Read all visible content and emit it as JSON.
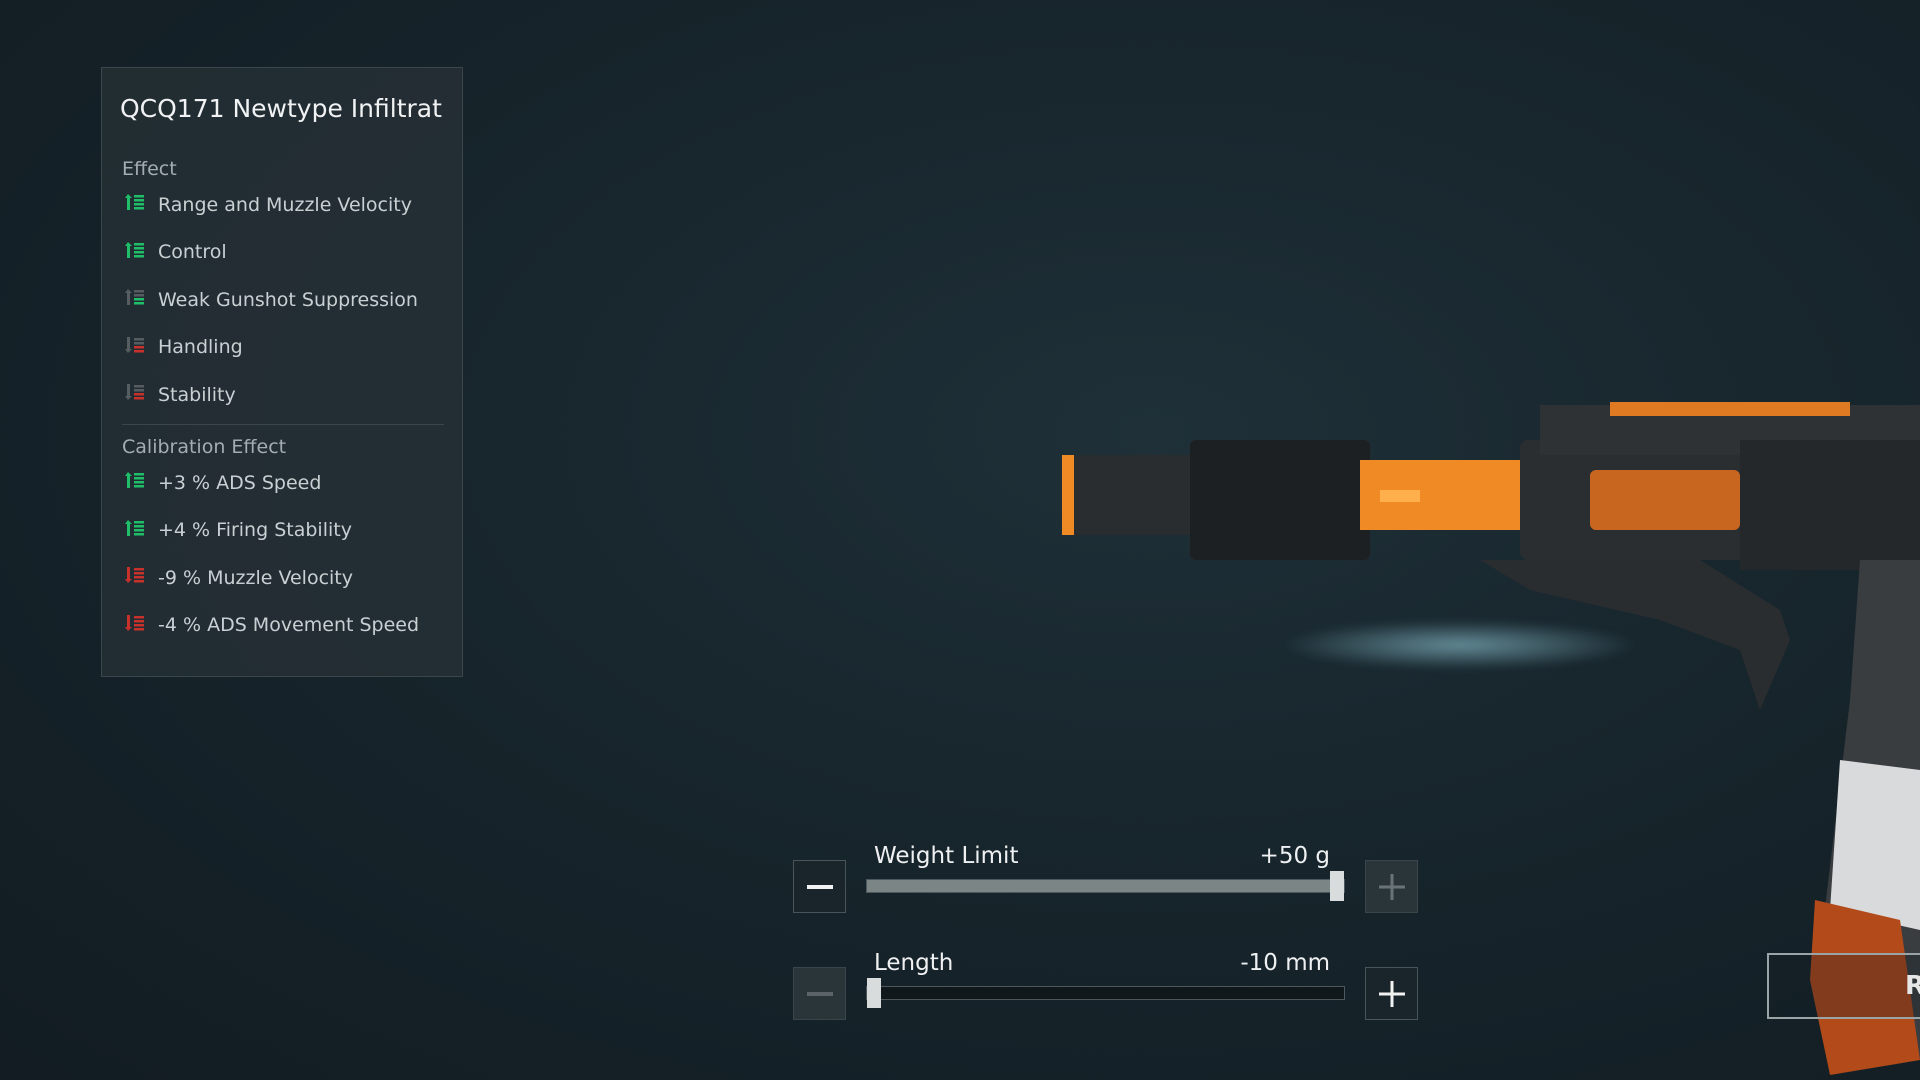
{
  "panel": {
    "title": "QCQ171 Newtype Infiltrat",
    "effect_header": "Effect",
    "effects": [
      {
        "label": "Range and Muzzle Velocity",
        "trend": "up-strong"
      },
      {
        "label": "Control",
        "trend": "up-strong"
      },
      {
        "label": "Weak Gunshot Suppression",
        "trend": "up-weak"
      },
      {
        "label": "Handling",
        "trend": "down-weak"
      },
      {
        "label": "Stability",
        "trend": "down-weak"
      }
    ],
    "calibration_header": "Calibration Effect",
    "calibration": [
      {
        "label": "+3 % ADS Speed",
        "trend": "up"
      },
      {
        "label": "+4 % Firing Stability",
        "trend": "up"
      },
      {
        "label": "-9 % Muzzle Velocity",
        "trend": "down"
      },
      {
        "label": "-4 % ADS Movement Speed",
        "trend": "down"
      }
    ]
  },
  "sliders": [
    {
      "label": "Weight Limit",
      "value": "+50 g",
      "level_percent": 100
    },
    {
      "label": "Length",
      "value": "-10 mm",
      "level_percent": 0
    }
  ],
  "corner_button": {
    "label": "R"
  },
  "colors": {
    "positive": "#1fbf6a",
    "negative": "#c8302c",
    "accent": "#f08a24"
  }
}
